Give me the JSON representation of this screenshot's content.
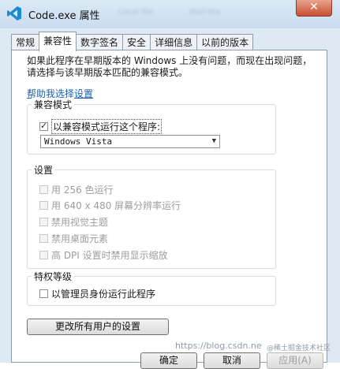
{
  "window": {
    "title": "Code.exe 属性",
    "close_glyph": "✕",
    "blurred_title_bits": [
      "Local file",
      "Mail-lite"
    ]
  },
  "tabs": [
    {
      "label": "常规",
      "active": false
    },
    {
      "label": "兼容性",
      "active": true
    },
    {
      "label": "数字签名",
      "active": false
    },
    {
      "label": "安全",
      "active": false
    },
    {
      "label": "详细信息",
      "active": false
    },
    {
      "label": "以前的版本",
      "active": false
    }
  ],
  "intro_text": "如果此程序在早期版本的 Windows 上没有问题，而现在出现问题，请选择与该早期版本匹配的兼容模式。",
  "help_link": "帮助我选择设置",
  "compat_mode": {
    "group_title": "兼容模式",
    "checkbox_label": "以兼容模式运行这个程序:",
    "checked": true,
    "selected_os": "Windows Vista"
  },
  "settings": {
    "group_title": "设置",
    "items": [
      {
        "label": "用 256 色运行",
        "checked": false,
        "disabled": true
      },
      {
        "label": "用 640 x 480 屏幕分辨率运行",
        "checked": false,
        "disabled": true
      },
      {
        "label": "禁用视觉主题",
        "checked": false,
        "disabled": true
      },
      {
        "label": "禁用桌面元素",
        "checked": false,
        "disabled": true
      },
      {
        "label": "高 DPI 设置时禁用显示缩放",
        "checked": false,
        "disabled": true
      }
    ]
  },
  "privilege": {
    "group_title": "特权等级",
    "checkbox_label": "以管理员身份运行此程序",
    "checked": false
  },
  "change_all_users_button": "更改所有用户的设置",
  "footer": {
    "ok": "确定",
    "cancel": "取消",
    "apply": "应用(A)"
  },
  "watermark": {
    "url": "https://blog.csdn.ne",
    "credit": "@稀土掘金技术社区"
  },
  "colors": {
    "accent_link": "#1a5fb4",
    "frame": "#dfe9f4",
    "close_button": "#c84e30"
  }
}
